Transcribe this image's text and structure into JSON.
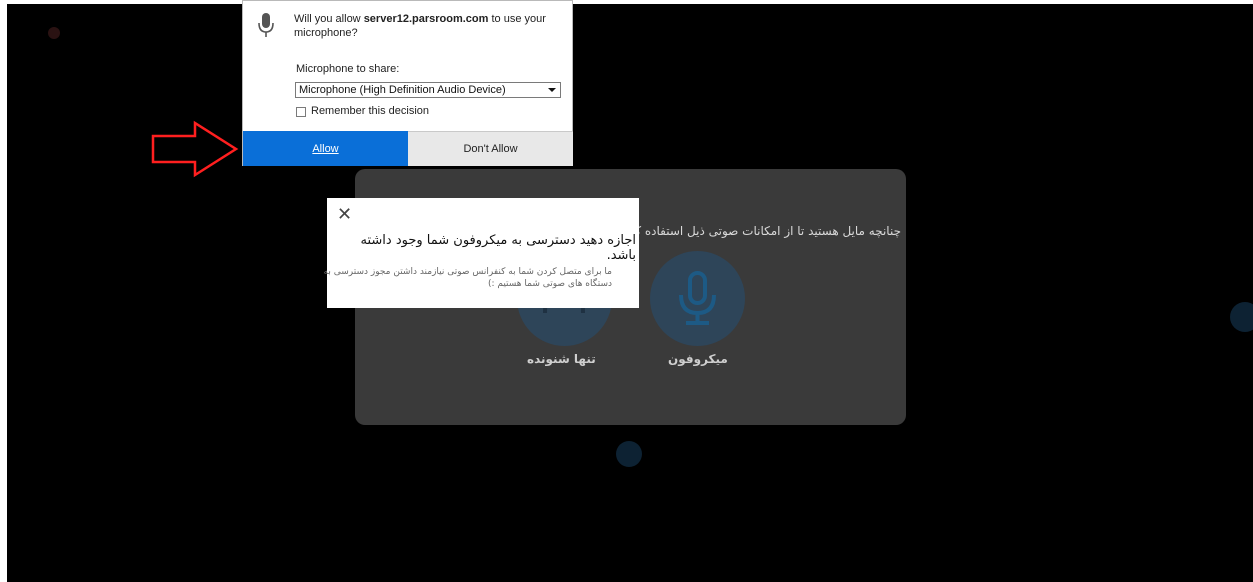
{
  "permission": {
    "question_prefix": "Will you allow ",
    "domain": "server12.parsroom.com",
    "question_suffix": " to use your microphone?",
    "share_label": "Microphone to share:",
    "selected_device": "Microphone (High Definition Audio Device)",
    "remember_label": "Remember this decision",
    "allow_label": "Allow",
    "deny_label": "Don't Allow"
  },
  "audio_modal": {
    "prompt": "چنانچه مایل هستید تا از امکانات صوتی ذیل استفاده کنید",
    "microphone_label": "میکروفون",
    "listen_only_label": "تنها شنونده"
  },
  "tip": {
    "title": "اجازه دهید دسترسی به میکروفون شما وجود داشته باشد.",
    "body": "ما برای متصل کردن شما به کنفرانس صوتی نیازمند داشتن مجوز دسترسی به دستگاه های صوتی شما هستیم :)"
  },
  "colors": {
    "allow_button": "#0a6fd8",
    "arrow": "#ff1f1f",
    "modal_bg": "#3a3a3a"
  }
}
